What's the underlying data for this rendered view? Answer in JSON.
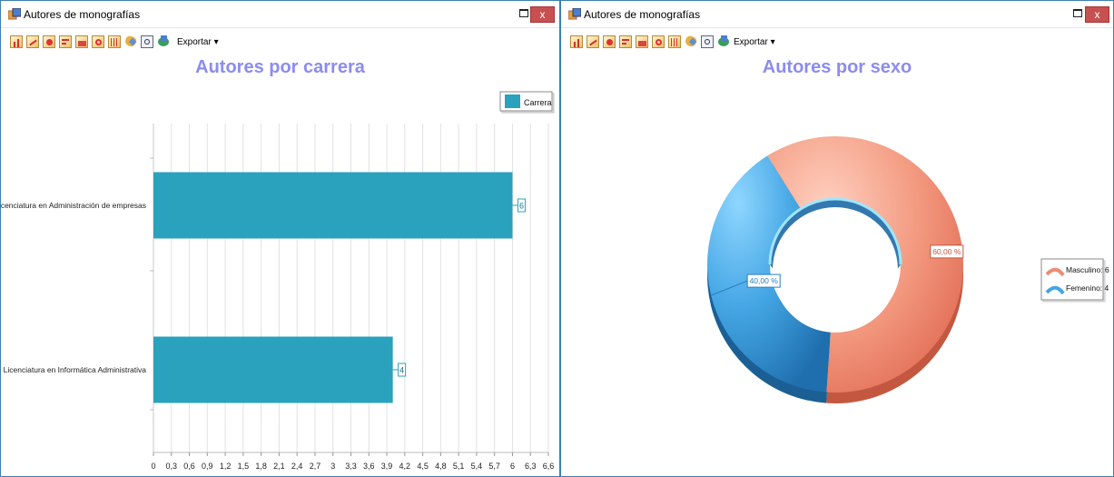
{
  "windows": [
    {
      "title": "Autores de monografías",
      "close_label": "x",
      "toolbar": {
        "export_label": "Exportar",
        "export_arrow": "▾"
      },
      "chart_title": "Autores por carrera",
      "chart_data": {
        "type": "bar",
        "orientation": "horizontal",
        "title": "Autores por carrera",
        "categories": [
          "Licenciatura en Administración de empresas",
          "Licenciatura en Informática Administrativa"
        ],
        "series": [
          {
            "name": "Carrera",
            "values": [
              6,
              4
            ],
            "color": "#2aa1bd"
          }
        ],
        "data_labels": [
          "6",
          "4"
        ],
        "x_ticks": [
          "0",
          "0,3",
          "0,6",
          "0,9",
          "1,2",
          "1,5",
          "1,8",
          "2,1",
          "2,4",
          "2,7",
          "3",
          "3,3",
          "3,6",
          "3,9",
          "4,2",
          "4,5",
          "4,8",
          "5,1",
          "5,4",
          "5,7",
          "6",
          "6,3",
          "6,6"
        ],
        "xlim": [
          0,
          6.6
        ],
        "grid": true,
        "legend_position": "top-right"
      }
    },
    {
      "title": "Autores de monografías",
      "close_label": "x",
      "toolbar": {
        "export_label": "Exportar",
        "export_arrow": "▾"
      },
      "chart_title": "Autores por sexo",
      "chart_data": {
        "type": "pie",
        "style": "doughnut-3d",
        "title": "Autores por sexo",
        "slices": [
          {
            "label": "Masculino: 6",
            "value": 6,
            "percent_label": "60,00 %",
            "color": "#f08a72"
          },
          {
            "label": "Femenino: 4",
            "value": 4,
            "percent_label": "40,00 %",
            "color": "#3fa6e6"
          }
        ],
        "legend_position": "right"
      }
    }
  ]
}
